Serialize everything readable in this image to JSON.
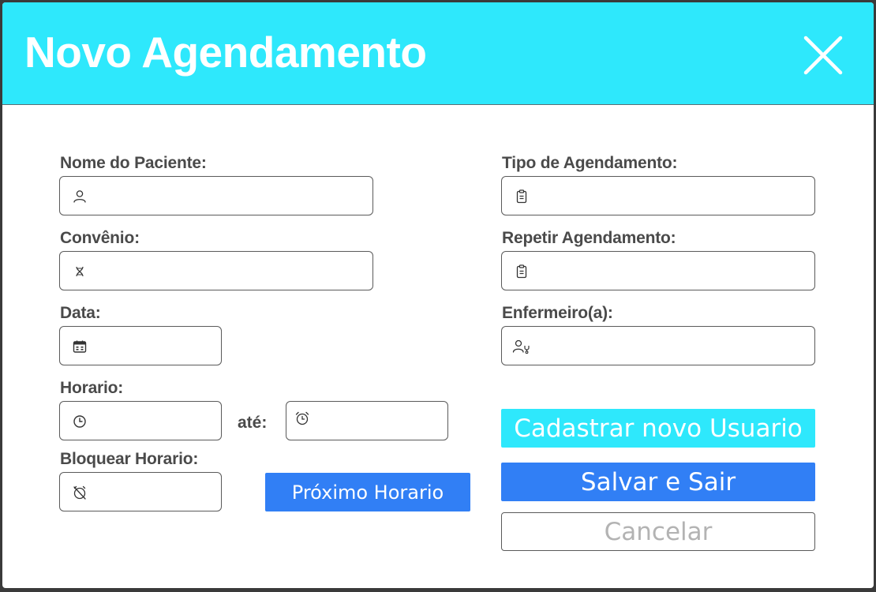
{
  "header": {
    "title": "Novo Agendamento"
  },
  "form": {
    "nome_label": "Nome do Paciente:",
    "convenio_label": "Convênio:",
    "data_label": "Data:",
    "horario_label": "Horario:",
    "ate_label": "até:",
    "bloquear_label": "Bloquear Horario:",
    "tipo_label": "Tipo de Agendamento:",
    "repetir_label": "Repetir Agendamento:",
    "enfermeiro_label": "Enfermeiro(a):"
  },
  "buttons": {
    "proximo": "Próximo Horario",
    "cadastrar": "Cadastrar novo Usuario",
    "salvar": "Salvar e Sair",
    "cancelar": "Cancelar"
  },
  "icons": {
    "close": "close-icon",
    "nome": "user-icon",
    "convenio": "dna-icon",
    "data": "calendar-icon",
    "horario_inicio": "clock-icon",
    "horario_fim": "alarm-clock-icon",
    "bloquear": "alarm-off-icon",
    "tipo": "clipboard-icon",
    "repetir": "clipboard-icon",
    "enfermeiro": "user-stethoscope-icon"
  },
  "colors": {
    "header": "#2ee8fc",
    "primary": "#317ff5",
    "cyan_button": "#2ee8fc",
    "label": "#4a4a4a",
    "cancel_text": "#b3b3b3"
  }
}
